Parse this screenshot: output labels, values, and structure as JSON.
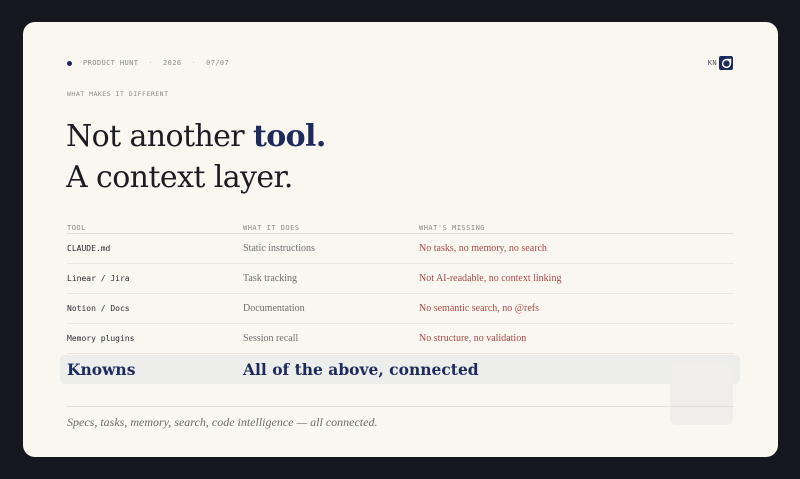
{
  "header": {
    "source": "PRODUCT HUNT",
    "year": "2026",
    "slide": "07/07",
    "brand": "KN"
  },
  "eyebrow": "WHAT MAKES IT DIFFERENT",
  "headline": {
    "line1_prefix": "Not another",
    "line1_accent": "tool.",
    "line2": "A context layer."
  },
  "table": {
    "columns": [
      "TOOL",
      "WHAT IT DOES",
      "WHAT'S MISSING"
    ],
    "rows": [
      {
        "tool": "CLAUDE.md",
        "does": "Static instructions",
        "missing": "No tasks, no memory, no search"
      },
      {
        "tool": "Linear / Jira",
        "does": "Task tracking",
        "missing": "Not AI-readable, no context linking"
      },
      {
        "tool": "Notion / Docs",
        "does": "Documentation",
        "missing": "No semantic search, no @refs"
      },
      {
        "tool": "Memory plugins",
        "does": "Session recall",
        "missing": "No structure, no validation"
      }
    ],
    "highlight": {
      "tool": "Knowns",
      "does": "All of the above, connected"
    }
  },
  "footnote": "Specs, tasks, memory, search, code intelligence — all connected.",
  "colors": {
    "background": "#17171f",
    "card": "#faf7f1",
    "accent": "#1d2a5c",
    "missing": "#a84a4a"
  }
}
